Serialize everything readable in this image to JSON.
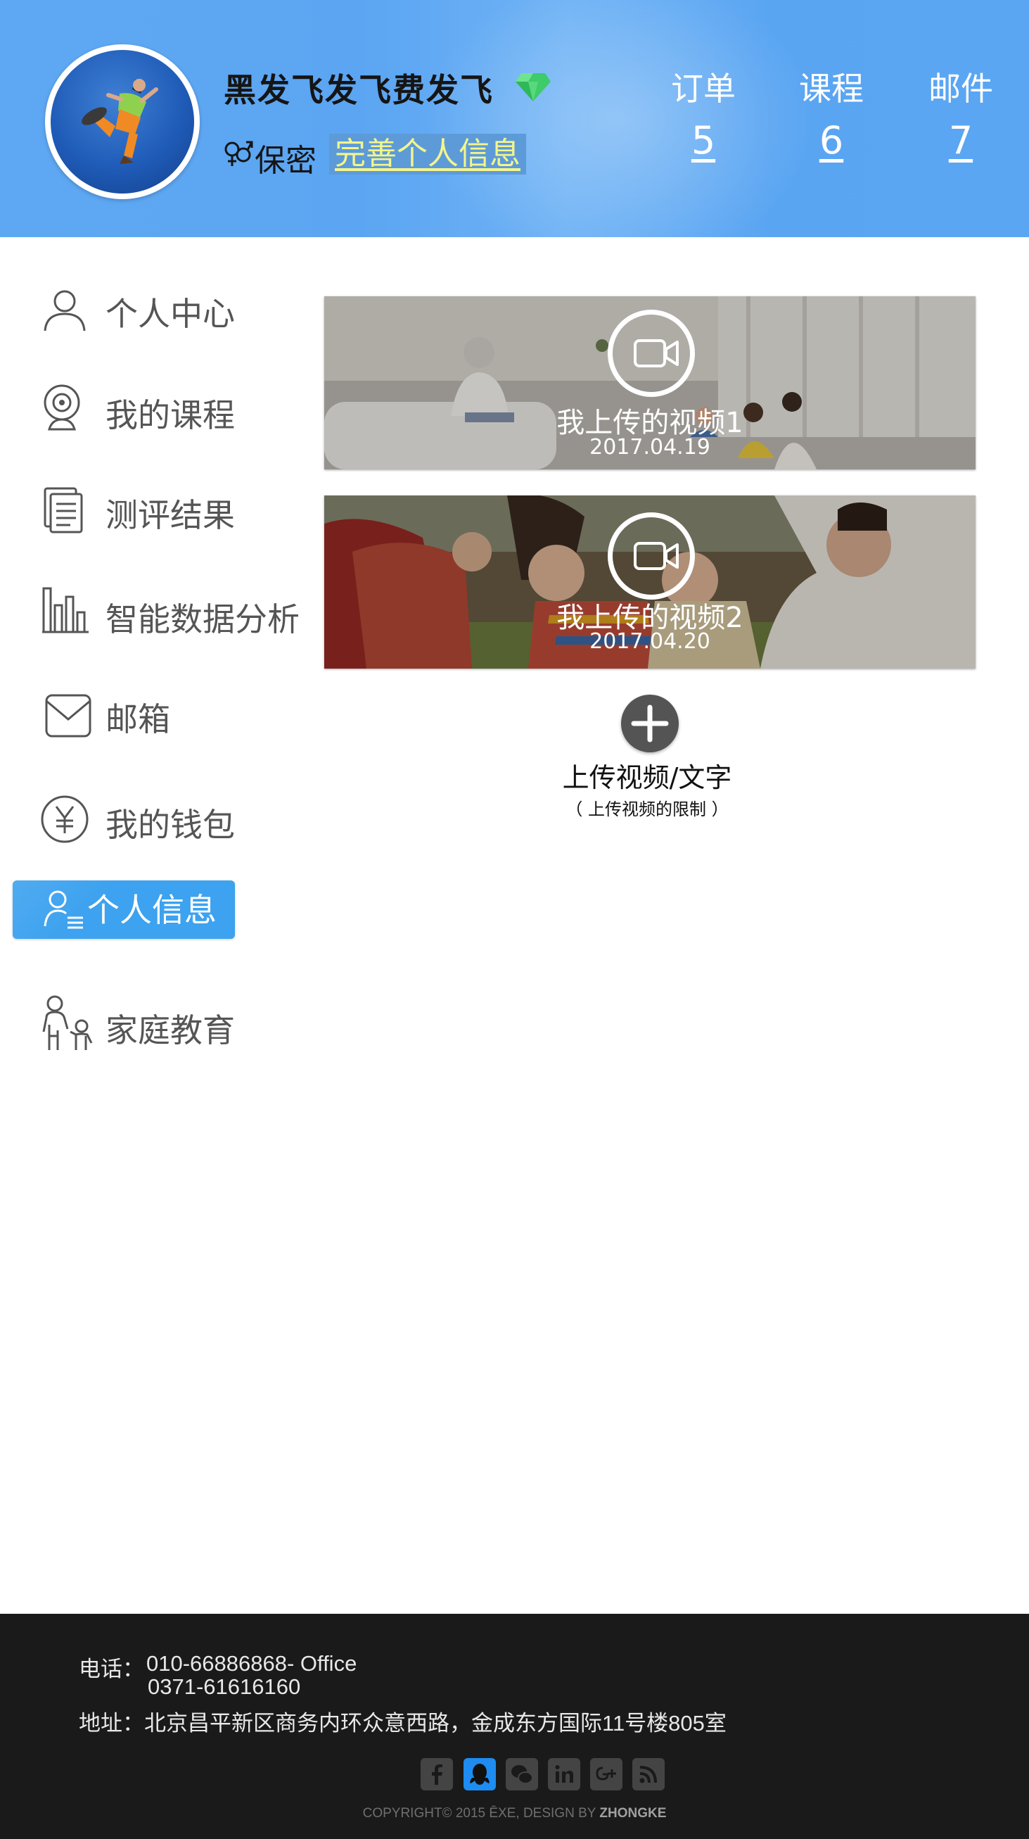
{
  "header": {
    "username": "黑发飞发飞费发飞",
    "gender": "保密",
    "complete_profile_link": "完善个人信息",
    "stats": [
      {
        "label": "订单",
        "value": "5"
      },
      {
        "label": "课程",
        "value": "6"
      },
      {
        "label": "邮件",
        "value": "7"
      }
    ],
    "colors": {
      "header_bg": "#5aa6f3",
      "link_bg": "#5d9bd8",
      "link_text": "#f3f58c"
    }
  },
  "sidebar": {
    "items": [
      {
        "label": "个人中心",
        "icon": "user-icon"
      },
      {
        "label": "我的课程",
        "icon": "webcam-icon"
      },
      {
        "label": "测评结果",
        "icon": "document-icon"
      },
      {
        "label": "智能数据分析",
        "icon": "bar-chart-icon"
      },
      {
        "label": "邮箱",
        "icon": "mail-icon"
      },
      {
        "label": "我的钱包",
        "icon": "yen-icon"
      },
      {
        "label": "个人信息",
        "icon": "user-info-icon",
        "active": true
      },
      {
        "label": "家庭教育",
        "icon": "family-icon"
      }
    ],
    "active_color": "#3da2ef"
  },
  "videos": [
    {
      "title": "我上传的视频1",
      "date": "2017.04.19"
    },
    {
      "title": "我上传的视频2",
      "date": "2017.04.20"
    }
  ],
  "upload": {
    "label": "上传视频/文字",
    "hint": "（ 上传视频的限制 ）"
  },
  "footer": {
    "phone_label": "电话：",
    "phone_1": "010-66886868- Office",
    "phone_2": "0371-61616160",
    "address_label": "地址：",
    "address": "北京昌平新区商务内环众意西路，金成东方国际11号楼805室",
    "social_icons": [
      "facebook-icon",
      "qq-icon",
      "wechat-icon",
      "linkedin-icon",
      "google-plus-icon",
      "rss-icon"
    ],
    "copyright_prefix": "COPYRIGHT© 2015 ĒXE, DESIGN BY ",
    "copyright_brand": "ZHONGKE"
  }
}
